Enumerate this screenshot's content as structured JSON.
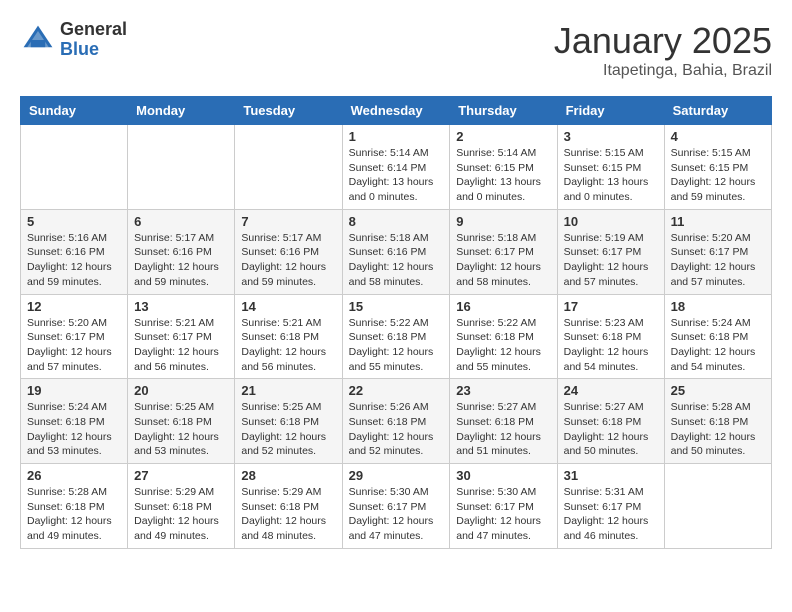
{
  "logo": {
    "general": "General",
    "blue": "Blue"
  },
  "header": {
    "month": "January 2025",
    "location": "Itapetinga, Bahia, Brazil"
  },
  "days_of_week": [
    "Sunday",
    "Monday",
    "Tuesday",
    "Wednesday",
    "Thursday",
    "Friday",
    "Saturday"
  ],
  "weeks": [
    [
      {
        "day": "",
        "sunrise": "",
        "sunset": "",
        "daylight": ""
      },
      {
        "day": "",
        "sunrise": "",
        "sunset": "",
        "daylight": ""
      },
      {
        "day": "",
        "sunrise": "",
        "sunset": "",
        "daylight": ""
      },
      {
        "day": "1",
        "sunrise": "Sunrise: 5:14 AM",
        "sunset": "Sunset: 6:14 PM",
        "daylight": "Daylight: 13 hours and 0 minutes."
      },
      {
        "day": "2",
        "sunrise": "Sunrise: 5:14 AM",
        "sunset": "Sunset: 6:15 PM",
        "daylight": "Daylight: 13 hours and 0 minutes."
      },
      {
        "day": "3",
        "sunrise": "Sunrise: 5:15 AM",
        "sunset": "Sunset: 6:15 PM",
        "daylight": "Daylight: 13 hours and 0 minutes."
      },
      {
        "day": "4",
        "sunrise": "Sunrise: 5:15 AM",
        "sunset": "Sunset: 6:15 PM",
        "daylight": "Daylight: 12 hours and 59 minutes."
      }
    ],
    [
      {
        "day": "5",
        "sunrise": "Sunrise: 5:16 AM",
        "sunset": "Sunset: 6:16 PM",
        "daylight": "Daylight: 12 hours and 59 minutes."
      },
      {
        "day": "6",
        "sunrise": "Sunrise: 5:17 AM",
        "sunset": "Sunset: 6:16 PM",
        "daylight": "Daylight: 12 hours and 59 minutes."
      },
      {
        "day": "7",
        "sunrise": "Sunrise: 5:17 AM",
        "sunset": "Sunset: 6:16 PM",
        "daylight": "Daylight: 12 hours and 59 minutes."
      },
      {
        "day": "8",
        "sunrise": "Sunrise: 5:18 AM",
        "sunset": "Sunset: 6:16 PM",
        "daylight": "Daylight: 12 hours and 58 minutes."
      },
      {
        "day": "9",
        "sunrise": "Sunrise: 5:18 AM",
        "sunset": "Sunset: 6:17 PM",
        "daylight": "Daylight: 12 hours and 58 minutes."
      },
      {
        "day": "10",
        "sunrise": "Sunrise: 5:19 AM",
        "sunset": "Sunset: 6:17 PM",
        "daylight": "Daylight: 12 hours and 57 minutes."
      },
      {
        "day": "11",
        "sunrise": "Sunrise: 5:20 AM",
        "sunset": "Sunset: 6:17 PM",
        "daylight": "Daylight: 12 hours and 57 minutes."
      }
    ],
    [
      {
        "day": "12",
        "sunrise": "Sunrise: 5:20 AM",
        "sunset": "Sunset: 6:17 PM",
        "daylight": "Daylight: 12 hours and 57 minutes."
      },
      {
        "day": "13",
        "sunrise": "Sunrise: 5:21 AM",
        "sunset": "Sunset: 6:17 PM",
        "daylight": "Daylight: 12 hours and 56 minutes."
      },
      {
        "day": "14",
        "sunrise": "Sunrise: 5:21 AM",
        "sunset": "Sunset: 6:18 PM",
        "daylight": "Daylight: 12 hours and 56 minutes."
      },
      {
        "day": "15",
        "sunrise": "Sunrise: 5:22 AM",
        "sunset": "Sunset: 6:18 PM",
        "daylight": "Daylight: 12 hours and 55 minutes."
      },
      {
        "day": "16",
        "sunrise": "Sunrise: 5:22 AM",
        "sunset": "Sunset: 6:18 PM",
        "daylight": "Daylight: 12 hours and 55 minutes."
      },
      {
        "day": "17",
        "sunrise": "Sunrise: 5:23 AM",
        "sunset": "Sunset: 6:18 PM",
        "daylight": "Daylight: 12 hours and 54 minutes."
      },
      {
        "day": "18",
        "sunrise": "Sunrise: 5:24 AM",
        "sunset": "Sunset: 6:18 PM",
        "daylight": "Daylight: 12 hours and 54 minutes."
      }
    ],
    [
      {
        "day": "19",
        "sunrise": "Sunrise: 5:24 AM",
        "sunset": "Sunset: 6:18 PM",
        "daylight": "Daylight: 12 hours and 53 minutes."
      },
      {
        "day": "20",
        "sunrise": "Sunrise: 5:25 AM",
        "sunset": "Sunset: 6:18 PM",
        "daylight": "Daylight: 12 hours and 53 minutes."
      },
      {
        "day": "21",
        "sunrise": "Sunrise: 5:25 AM",
        "sunset": "Sunset: 6:18 PM",
        "daylight": "Daylight: 12 hours and 52 minutes."
      },
      {
        "day": "22",
        "sunrise": "Sunrise: 5:26 AM",
        "sunset": "Sunset: 6:18 PM",
        "daylight": "Daylight: 12 hours and 52 minutes."
      },
      {
        "day": "23",
        "sunrise": "Sunrise: 5:27 AM",
        "sunset": "Sunset: 6:18 PM",
        "daylight": "Daylight: 12 hours and 51 minutes."
      },
      {
        "day": "24",
        "sunrise": "Sunrise: 5:27 AM",
        "sunset": "Sunset: 6:18 PM",
        "daylight": "Daylight: 12 hours and 50 minutes."
      },
      {
        "day": "25",
        "sunrise": "Sunrise: 5:28 AM",
        "sunset": "Sunset: 6:18 PM",
        "daylight": "Daylight: 12 hours and 50 minutes."
      }
    ],
    [
      {
        "day": "26",
        "sunrise": "Sunrise: 5:28 AM",
        "sunset": "Sunset: 6:18 PM",
        "daylight": "Daylight: 12 hours and 49 minutes."
      },
      {
        "day": "27",
        "sunrise": "Sunrise: 5:29 AM",
        "sunset": "Sunset: 6:18 PM",
        "daylight": "Daylight: 12 hours and 49 minutes."
      },
      {
        "day": "28",
        "sunrise": "Sunrise: 5:29 AM",
        "sunset": "Sunset: 6:18 PM",
        "daylight": "Daylight: 12 hours and 48 minutes."
      },
      {
        "day": "29",
        "sunrise": "Sunrise: 5:30 AM",
        "sunset": "Sunset: 6:17 PM",
        "daylight": "Daylight: 12 hours and 47 minutes."
      },
      {
        "day": "30",
        "sunrise": "Sunrise: 5:30 AM",
        "sunset": "Sunset: 6:17 PM",
        "daylight": "Daylight: 12 hours and 47 minutes."
      },
      {
        "day": "31",
        "sunrise": "Sunrise: 5:31 AM",
        "sunset": "Sunset: 6:17 PM",
        "daylight": "Daylight: 12 hours and 46 minutes."
      },
      {
        "day": "",
        "sunrise": "",
        "sunset": "",
        "daylight": ""
      }
    ]
  ]
}
